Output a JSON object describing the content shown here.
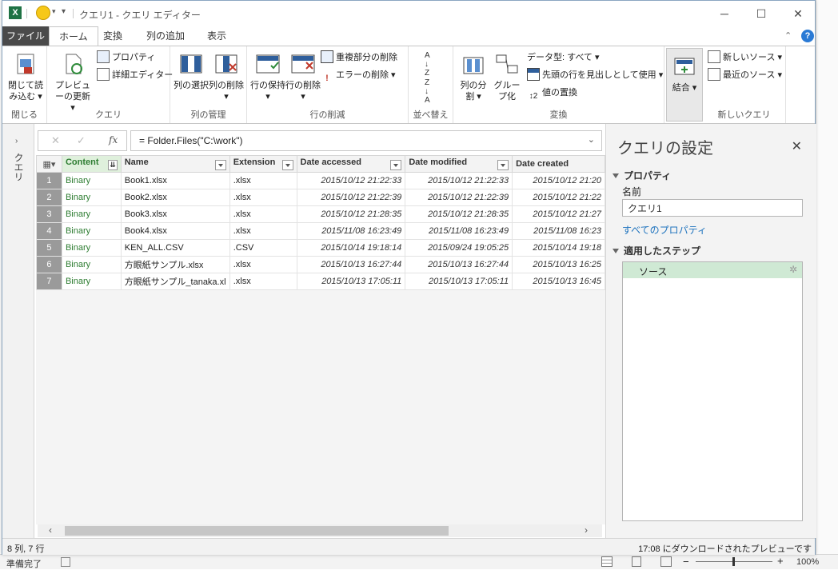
{
  "titlebar": {
    "title": "クエリ1 - クエリ エディター",
    "app_icon": "X"
  },
  "tabs": [
    "ファイル",
    "ホーム",
    "変換",
    "列の追加",
    "表示"
  ],
  "ribbon": {
    "close_group": {
      "button": "閉じて読み込む",
      "label": "閉じる"
    },
    "query_group": {
      "refresh": "プレビューの更新",
      "properties": "プロパティ",
      "advanced_editor": "詳細エディター",
      "label": "クエリ"
    },
    "column_group": {
      "select": "列の選択",
      "remove": "列の削除",
      "label": "列の管理"
    },
    "row_group": {
      "keep": "行の保持",
      "remove": "行の削除",
      "remove_dup": "重複部分の削除",
      "remove_err": "エラーの削除",
      "label": "行の削減"
    },
    "sort_group": {
      "label": "並べ替え"
    },
    "transform_group": {
      "split": "列の分割",
      "group_by": "グループ化",
      "data_type": "データ型: すべて",
      "first_row_header": "先頭の行を見出しとして使用",
      "replace": "値の置換",
      "label": "変換"
    },
    "combine_group": {
      "button": "結合"
    },
    "newquery_group": {
      "new_source": "新しいソース",
      "recent_source": "最近のソース",
      "label": "新しいクエリ"
    }
  },
  "left_panel": {
    "label": "クエリ"
  },
  "formula_bar": {
    "formula": "= Folder.Files(\"C:\\work\")"
  },
  "grid": {
    "columns": [
      "Content",
      "Name",
      "Extension",
      "Date accessed",
      "Date modified",
      "Date created"
    ],
    "rows": [
      [
        "1",
        "Binary",
        "Book1.xlsx",
        ".xlsx",
        "2015/10/12 21:22:33",
        "2015/10/12 21:22:33",
        "2015/10/12 21:20"
      ],
      [
        "2",
        "Binary",
        "Book2.xlsx",
        ".xlsx",
        "2015/10/12 21:22:39",
        "2015/10/12 21:22:39",
        "2015/10/12 21:22"
      ],
      [
        "3",
        "Binary",
        "Book3.xlsx",
        ".xlsx",
        "2015/10/12 21:28:35",
        "2015/10/12 21:28:35",
        "2015/10/12 21:27"
      ],
      [
        "4",
        "Binary",
        "Book4.xlsx",
        ".xlsx",
        "2015/11/08 16:23:49",
        "2015/11/08 16:23:49",
        "2015/11/08 16:23"
      ],
      [
        "5",
        "Binary",
        "KEN_ALL.CSV",
        ".CSV",
        "2015/10/14 19:18:14",
        "2015/09/24 19:05:25",
        "2015/10/14 19:18"
      ],
      [
        "6",
        "Binary",
        "方眼紙サンプル.xlsx",
        ".xlsx",
        "2015/10/13 16:27:44",
        "2015/10/13 16:27:44",
        "2015/10/13 16:25"
      ],
      [
        "7",
        "Binary",
        "方眼紙サンプル_tanaka.xl",
        ".xlsx",
        "2015/10/13 17:05:11",
        "2015/10/13 17:05:11",
        "2015/10/13 16:45"
      ]
    ]
  },
  "status": {
    "left": "8 列, 7 行",
    "right": "17:08 にダウンロードされたプレビューです"
  },
  "settings": {
    "title": "クエリの設定",
    "properties_header": "プロパティ",
    "name_label": "名前",
    "name_value": "クエリ1",
    "all_properties": "すべてのプロパティ",
    "steps_header": "適用したステップ",
    "steps": [
      "ソース"
    ]
  },
  "excel_status": {
    "ready": "準備完了",
    "zoom": "100%"
  }
}
